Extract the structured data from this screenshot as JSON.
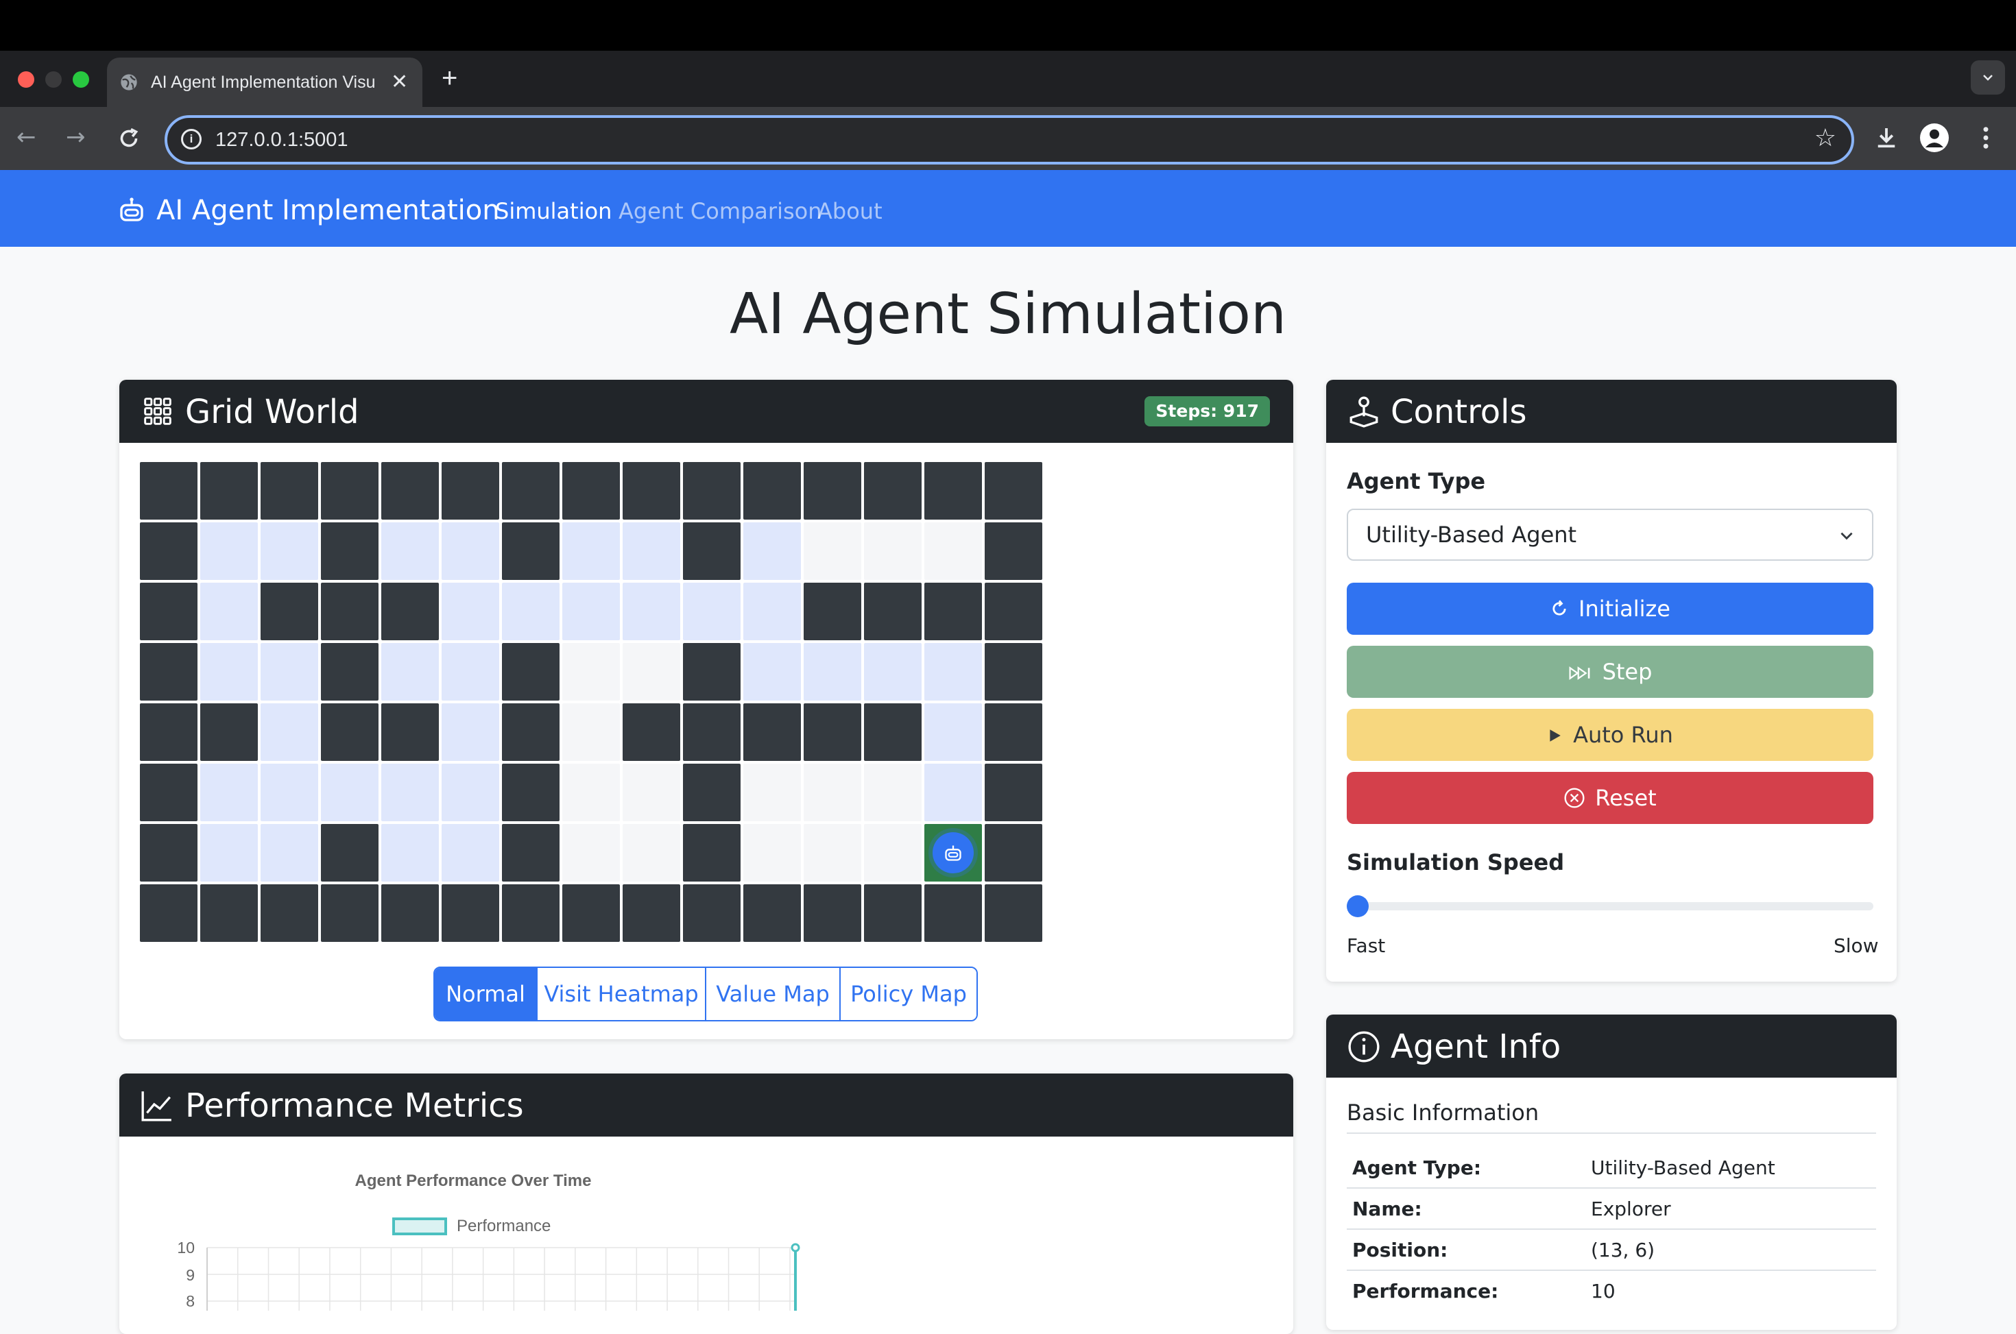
{
  "browser": {
    "tab_title": "AI Agent Implementation Visu",
    "url": "127.0.0.1:5001",
    "new_tab_symbol": "+",
    "close_symbol": "✕"
  },
  "navbar": {
    "brand": "AI Agent Implementation",
    "links": [
      "Simulation",
      "Agent Comparison",
      "About"
    ],
    "active_link": "Simulation"
  },
  "page_title": "AI Agent Simulation",
  "grid_world": {
    "title": "Grid World",
    "steps_badge": "Steps: 917",
    "legend": {
      "W": "wall",
      "V": "visited",
      "E": "empty",
      "A": "agent"
    },
    "rows": [
      "WWWWWWWWWWWWWWW",
      "WVVWVVWVVWVEEEW",
      "WVWWWVVVVVVWWWW",
      "WVVWVVWEEWVVVVW",
      "WWVWWVWEWWWWWVW",
      "WVVVVVWEEWEEEVW",
      "WVVWVVWEEWEEEAW",
      "WWWWWWWWWWWWWWW"
    ],
    "view_modes": [
      "Normal",
      "Visit Heatmap",
      "Value Map",
      "Policy Map"
    ],
    "active_view": "Normal"
  },
  "controls": {
    "title": "Controls",
    "agent_type_label": "Agent Type",
    "agent_type_value": "Utility-Based Agent",
    "buttons": {
      "initialize": "Initialize",
      "step": "Step",
      "auto_run": "Auto Run",
      "reset": "Reset"
    },
    "speed_label": "Simulation Speed",
    "speed_value": 0,
    "speed_min_label": "Fast",
    "speed_max_label": "Slow"
  },
  "agent_info": {
    "title": "Agent Info",
    "subtitle": "Basic Information",
    "rows": [
      {
        "key": "Agent Type:",
        "value": "Utility-Based Agent"
      },
      {
        "key": "Name:",
        "value": "Explorer"
      },
      {
        "key": "Position:",
        "value": "(13, 6)"
      },
      {
        "key": "Performance:",
        "value": "10"
      }
    ]
  },
  "performance": {
    "title": "Performance Metrics",
    "chart_data": {
      "type": "line",
      "title": "Agent Performance Over Time",
      "series": [
        {
          "name": "Performance",
          "values": [
            10
          ]
        }
      ],
      "y_ticks_visible": [
        10,
        9,
        8
      ]
    }
  },
  "colors": {
    "primary": "#3073f1",
    "dark": "#212529",
    "success_muted": "#85b394",
    "warning_muted": "#f7d77f",
    "danger": "#d4404b"
  }
}
